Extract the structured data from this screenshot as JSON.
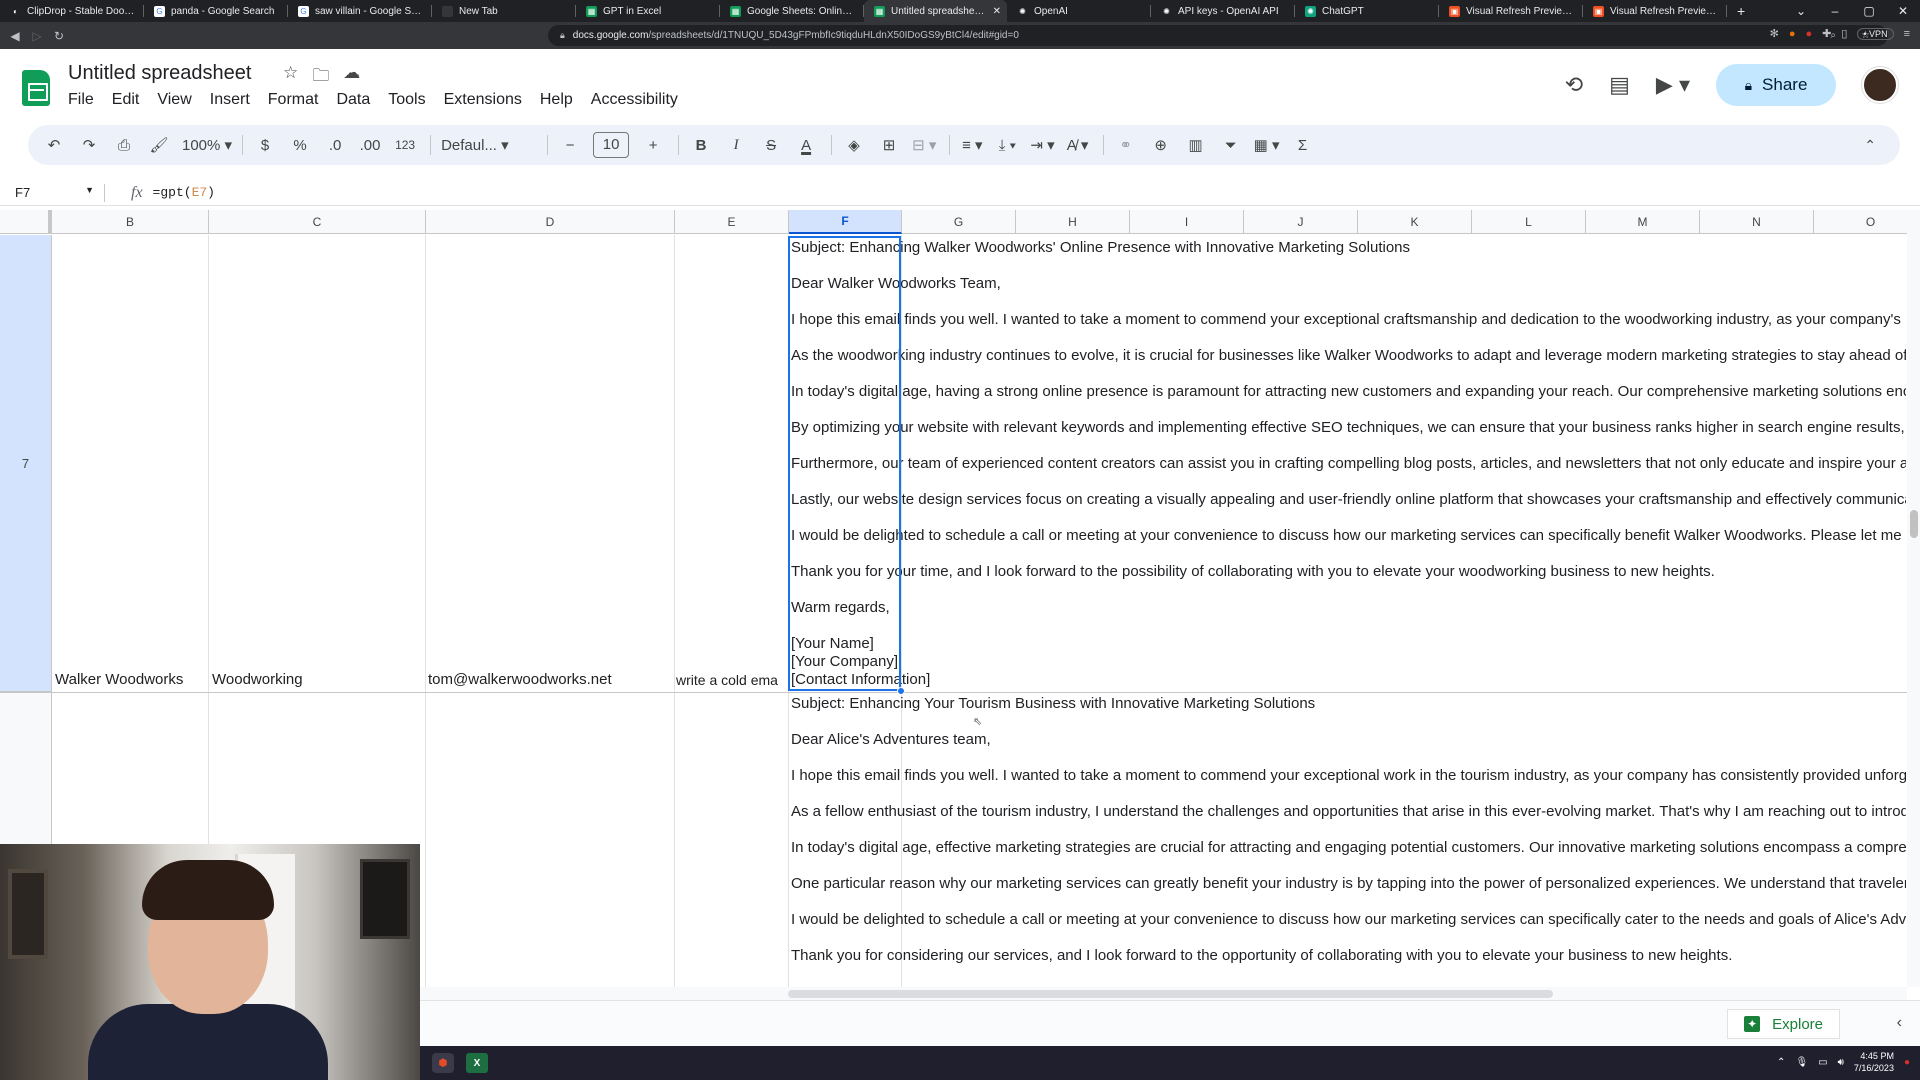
{
  "browser": {
    "tabs": [
      {
        "label": "ClipDrop - Stable Doodle",
        "fav_color": "#202124",
        "fav": "◐"
      },
      {
        "label": "panda - Google Search",
        "fav_color": "#ffffff",
        "fav": "G"
      },
      {
        "label": "saw villain - Google Search",
        "fav_color": "#ffffff",
        "fav": "G"
      },
      {
        "label": "New Tab",
        "fav_color": "#35363a",
        "fav": ""
      },
      {
        "label": "GPT in Excel",
        "fav_color": "#0f9d58",
        "fav": "▦"
      },
      {
        "label": "Google Sheets: Online Spreadsh",
        "fav_color": "#0f9d58",
        "fav": "▦"
      },
      {
        "label": "Untitled spreadsheet - Goo",
        "fav_color": "#0f9d58",
        "fav": "▦",
        "active": true
      },
      {
        "label": "OpenAI",
        "fav_color": "#202124",
        "fav": "✺"
      },
      {
        "label": "API keys - OpenAI API",
        "fav_color": "#202124",
        "fav": "✺"
      },
      {
        "label": "ChatGPT",
        "fav_color": "#10a37f",
        "fav": "✺"
      },
      {
        "label": "Visual Refresh Preview - Micr",
        "fav_color": "#f25022",
        "fav": "▣"
      },
      {
        "label": "Visual Refresh Preview - Micr",
        "fav_color": "#f25022",
        "fav": "▣"
      }
    ],
    "new_tab": "+",
    "url_prefix": "docs.google.com",
    "url_rest": "/spreadsheets/d/1TNUQU_5D43gFPmbfIc9tiqduHLdnX50IDoGS9yBtCl4/edit#gid=0",
    "vpn": "• VPN"
  },
  "sheets": {
    "title": "Untitled spreadsheet",
    "menu": [
      "File",
      "Edit",
      "View",
      "Insert",
      "Format",
      "Data",
      "Tools",
      "Extensions",
      "Help",
      "Accessibility"
    ],
    "share_label": "Share",
    "toolbar": {
      "zoom": "100%",
      "currency": "$",
      "percent": "%",
      "dec_decrease": ".0",
      "dec_increase": ".00",
      "number_format": "123",
      "font": "Defaul...",
      "font_size": "10",
      "minus": "−",
      "plus": "+",
      "bold": "B",
      "italic": "I",
      "strike": "S",
      "textcolor": "A",
      "sigma": "Σ"
    },
    "namebox": "F7",
    "formula_prefix": "=gpt(",
    "formula_ref": "E7",
    "formula_suffix": ")",
    "explore_label": "Explore"
  },
  "grid": {
    "columns": [
      "B",
      "C",
      "D",
      "E",
      "F",
      "G",
      "H",
      "I",
      "J",
      "K",
      "L",
      "M",
      "N",
      "O"
    ],
    "selected_column": "F",
    "row7": {
      "label": "7",
      "B": "Walker Woodworks",
      "C": "Woodworking",
      "D": "tom@walkerwoodworks.net",
      "E": "write a cold ema",
      "F_lines": [
        "Subject: Enhancing Walker Woodworks' Online Presence with Innovative Marketing Solutions",
        "Dear Walker Woodworks Team,",
        "I hope this email finds you well. I wanted to take a moment to commend your exceptional craftsmanship and dedication to the woodworking industry, as your company's r",
        "As the woodworking industry continues to evolve, it is crucial for businesses like Walker Woodworks to adapt and leverage modern marketing strategies to stay ahead of",
        "In today's digital age, having a strong online presence is paramount for attracting new customers and expanding your reach. Our comprehensive marketing solutions enc",
        "By optimizing your website with relevant keywords and implementing effective SEO techniques, we can ensure that your business ranks higher in search engine results,",
        "Furthermore, our team of experienced content creators can assist you in crafting compelling blog posts, articles, and newsletters that not only educate and inspire your a",
        "Lastly, our website design services focus on creating a visually appealing and user-friendly online platform that showcases your craftsmanship and effectively communica",
        "I would be delighted to schedule a call or meeting at your convenience to discuss how our marketing services can specifically benefit Walker Woodworks. Please let me k",
        "Thank you for your time, and I look forward to the possibility of collaborating with you to elevate your woodworking business to new heights.",
        "Warm regards,"
      ],
      "F_signature": [
        "[Your Name]",
        "[Your Company]",
        "[Contact Information]"
      ]
    },
    "row8": {
      "F_lines": [
        "Subject: Enhancing Your Tourism Business with Innovative Marketing Solutions",
        "Dear Alice's Adventures team,",
        "I hope this email finds you well. I wanted to take a moment to commend your exceptional work in the tourism industry, as your company has consistently provided unforg",
        "As a fellow enthusiast of the tourism industry, I understand the challenges and opportunities that arise in this ever-evolving market. That's why I am reaching out to introd",
        "In today's digital age, effective marketing strategies are crucial for attracting and engaging potential customers. Our innovative marketing solutions encompass a compre",
        "One particular reason why our marketing services can greatly benefit your industry is by tapping into the power of personalized experiences. We understand that traveler",
        "I would be delighted to schedule a call or meeting at your convenience to discuss how our marketing services can specifically cater to the needs and goals of Alice's Adv",
        "Thank you for considering our services, and I look forward to the opportunity of collaborating with you to elevate your business to new heights."
      ]
    }
  },
  "taskbar": {
    "time": "4:45 PM",
    "date": "7/16/2023"
  }
}
